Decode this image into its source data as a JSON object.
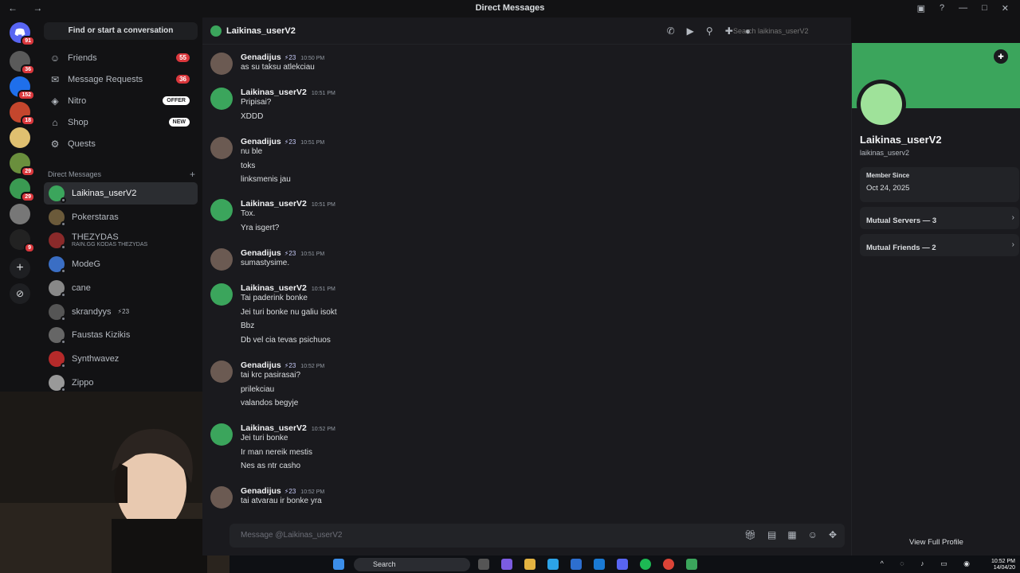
{
  "window": {
    "title": "Direct Messages",
    "nav_arrows": "← →"
  },
  "server_rail": {
    "home_badge": "91",
    "servers": [
      {
        "badge": "36",
        "color": "#5a5a5a"
      },
      {
        "badge": "152",
        "color": "#1f6feb"
      },
      {
        "badge": "18",
        "color": "#c4462d"
      },
      {
        "badge": "",
        "color": "#e0c070"
      },
      {
        "badge": "29",
        "color": "#6a8f3d"
      },
      {
        "badge": "29",
        "color": "#3a9a52"
      },
      {
        "badge": "",
        "color": "#777"
      },
      {
        "badge": "9",
        "color": "#222"
      }
    ]
  },
  "dm_panel": {
    "find_label": "Find or start a conversation",
    "nav": [
      {
        "label": "Friends",
        "count": "55",
        "tag": ""
      },
      {
        "label": "Message Requests",
        "count": "36",
        "tag": ""
      },
      {
        "label": "Nitro",
        "count": "",
        "tag": "OFFER"
      },
      {
        "label": "Shop",
        "count": "",
        "tag": "NEW"
      },
      {
        "label": "Quests",
        "count": "",
        "tag": ""
      }
    ],
    "section_title": "Direct Messages",
    "dms": [
      {
        "name": "Laikinas_userV2",
        "sub": "",
        "badge": "",
        "active": true,
        "color": "#3ba55c"
      },
      {
        "name": "Pokerstaras",
        "sub": "",
        "badge": "",
        "active": false,
        "color": "#6b5a3a"
      },
      {
        "name": "THEZYDAS",
        "sub": "RAIN.GG KODAS THEZYDAS",
        "badge": "",
        "active": false,
        "color": "#8a2a2a"
      },
      {
        "name": "ModeG",
        "sub": "",
        "badge": "",
        "active": false,
        "color": "#3a6ec4"
      },
      {
        "name": "cane",
        "sub": "",
        "badge": "",
        "active": false,
        "color": "#888"
      },
      {
        "name": "skrandyys",
        "sub": "",
        "badge": "23",
        "active": false,
        "color": "#555"
      },
      {
        "name": "Faustas Kizikis",
        "sub": "",
        "badge": "",
        "active": false,
        "color": "#666"
      },
      {
        "name": "Synthwavez",
        "sub": "",
        "badge": "",
        "active": false,
        "color": "#b52a2a"
      },
      {
        "name": "Zippo",
        "sub": "",
        "badge": "",
        "active": false,
        "color": "#999"
      }
    ]
  },
  "chat": {
    "recipient": "Laikinas_userV2",
    "search_placeholder": "Search laikinas_userV2",
    "composer_placeholder": "Message @Laikinas_userV2",
    "messages": [
      {
        "author": "Genadijus",
        "badge": "23",
        "time": "10:50 PM",
        "lines": [
          "as su taksu atlekciau"
        ]
      },
      {
        "author": "Laikinas_userV2",
        "badge": "",
        "time": "10:51 PM",
        "lines": [
          "Pripisai?",
          "XDDD"
        ]
      },
      {
        "author": "Genadijus",
        "badge": "23",
        "time": "10:51 PM",
        "lines": [
          "nu ble",
          "toks",
          "linksmenis jau"
        ]
      },
      {
        "author": "Laikinas_userV2",
        "badge": "",
        "time": "10:51 PM",
        "lines": [
          "Tox.",
          "Yra isgert?"
        ]
      },
      {
        "author": "Genadijus",
        "badge": "23",
        "time": "10:51 PM",
        "lines": [
          "sumastysime."
        ]
      },
      {
        "author": "Laikinas_userV2",
        "badge": "",
        "time": "10:51 PM",
        "lines": [
          "Tai paderink bonke",
          "Jei turi bonke nu galiu isokt",
          "Bbz",
          "Db vel cia tevas psichuos"
        ]
      },
      {
        "author": "Genadijus",
        "badge": "23",
        "time": "10:52 PM",
        "lines": [
          "tai krc pasirasai?",
          "prilekciau",
          "valandos begyje"
        ]
      },
      {
        "author": "Laikinas_userV2",
        "badge": "",
        "time": "10:52 PM",
        "lines": [
          "Jei turi bonke",
          "Ir man nereik mestis",
          "Nes as ntr casho"
        ]
      },
      {
        "author": "Genadijus",
        "badge": "23",
        "time": "10:52 PM",
        "lines": [
          "tai atvarau ir bonke yra"
        ]
      }
    ]
  },
  "profile": {
    "display_name": "Laikinas_userV2",
    "username": "laikinas_userv2",
    "member_since_label": "Member Since",
    "member_since": "Oct 24, 2025",
    "mutual_servers": "Mutual Servers — 3",
    "mutual_friends": "Mutual Friends — 2",
    "view_full": "View Full Profile"
  },
  "taskbar": {
    "search": "Search",
    "clock_time": "10:52 PM",
    "clock_date": "14/04/20"
  }
}
